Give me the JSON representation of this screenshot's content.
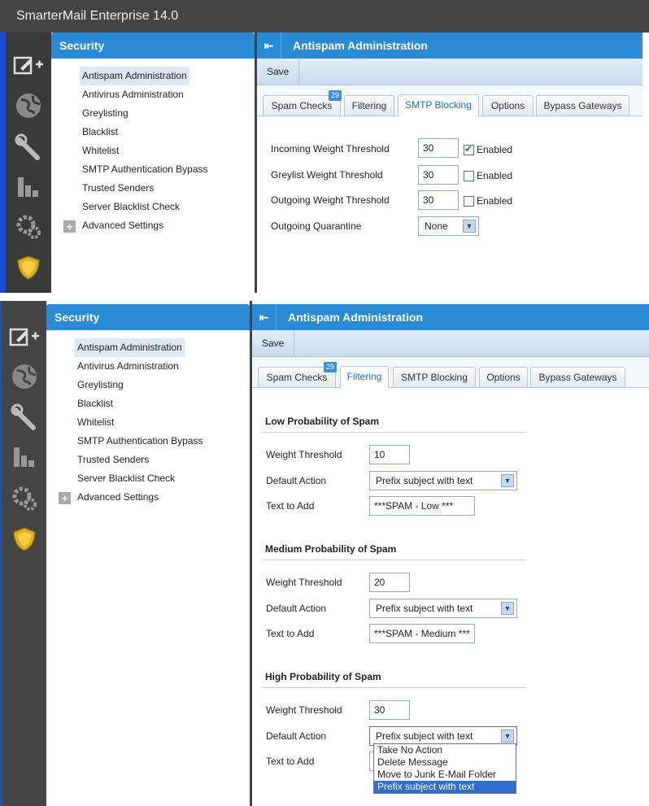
{
  "app_title": "SmarterMail Enterprise 14.0",
  "sidebar": {
    "title": "Security",
    "items": [
      "Antispam Administration",
      "Antivirus Administration",
      "Greylisting",
      "Blacklist",
      "Whitelist",
      "SMTP Authentication Bypass",
      "Trusted Senders",
      "Server Blacklist Check"
    ],
    "advanced": "Advanced Settings"
  },
  "rail_icons": [
    "compose-icon",
    "globe-icon",
    "wrench-icon",
    "reports-icon",
    "gear-icon",
    "shield-icon"
  ],
  "main": {
    "title": "Antispam Administration",
    "save_label": "Save",
    "tabs": [
      "Spam Checks",
      "Filtering",
      "SMTP Blocking",
      "Options",
      "Bypass Gateways"
    ],
    "badge": "29"
  },
  "smtp_blocking": {
    "rows": [
      {
        "label": "Incoming Weight Threshold",
        "value": "30",
        "enabled_label": "Enabled",
        "checked": true
      },
      {
        "label": "Greylist Weight Threshold",
        "value": "30",
        "enabled_label": "Enabled",
        "checked": false
      },
      {
        "label": "Outgoing Weight Threshold",
        "value": "30",
        "enabled_label": "Enabled",
        "checked": false
      }
    ],
    "quarantine_label": "Outgoing Quarantine",
    "quarantine_value": "None"
  },
  "filtering": {
    "weight_label": "Weight Threshold",
    "action_label": "Default Action",
    "text_label": "Text to Add",
    "low": {
      "title": "Low Probability of Spam",
      "weight": "10",
      "action": "Prefix subject with text",
      "text": "***SPAM - Low ***"
    },
    "medium": {
      "title": "Medium Probability of Spam",
      "weight": "20",
      "action": "Prefix subject with text",
      "text": "***SPAM - Medium ***"
    },
    "high": {
      "title": "High Probability of Spam",
      "weight": "30",
      "action": "Prefix subject with text"
    },
    "dropdown_options": [
      "Take No Action",
      "Delete Message",
      "Move to Junk E-Mail Folder",
      "Prefix subject with text"
    ]
  },
  "colors": {
    "header": "#2a8ad4",
    "rail": "#3a3a3a",
    "accent_blue": "#1b4fd4",
    "highlight": "#2f6ecf"
  }
}
